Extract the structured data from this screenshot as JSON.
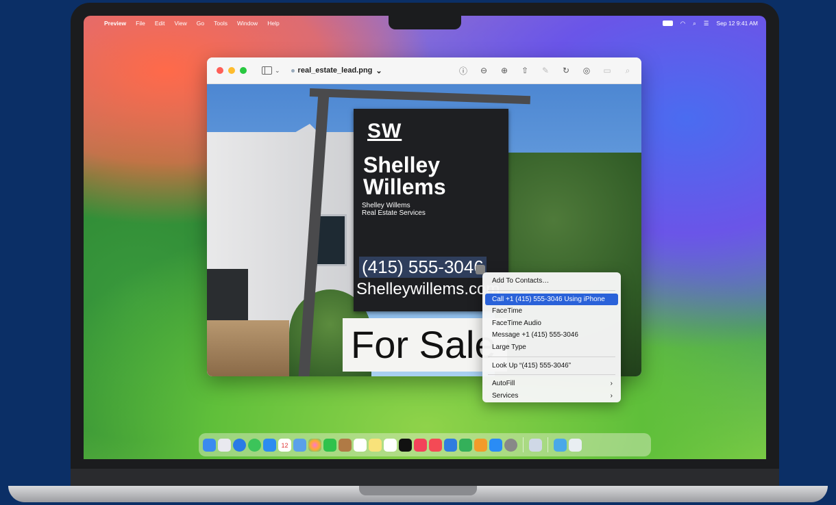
{
  "menubar": {
    "apple_icon": "apple-icon",
    "app_name": "Preview",
    "items": [
      "File",
      "Edit",
      "View",
      "Go",
      "Tools",
      "Window",
      "Help"
    ],
    "status": {
      "datetime": "Sep 12 9:41 AM"
    }
  },
  "window": {
    "filename": "real_estate_lead.png",
    "toolbar_icons": [
      "info-icon",
      "zoom-out-icon",
      "zoom-in-icon",
      "share-icon",
      "markup-icon",
      "rotate-icon",
      "highlight-icon",
      "form-icon",
      "search-icon"
    ]
  },
  "photo": {
    "sign": {
      "monogram": "SW",
      "name_line1": "Shelley",
      "name_line2": "Willems",
      "sub_line1": "Shelley Willems",
      "sub_line2": "Real Estate Services",
      "phone": "(415) 555-3046",
      "website": "Shelleywillems.com"
    },
    "for_sale": "For Sale"
  },
  "context_menu": {
    "items": [
      {
        "label": "Add To Contacts…"
      },
      {
        "label": "Call +1 (415) 555-3046 Using iPhone",
        "selected": true
      },
      {
        "label": "FaceTime"
      },
      {
        "label": "FaceTime Audio"
      },
      {
        "label": "Message +1 (415) 555-3046"
      },
      {
        "label": "Large Type"
      },
      {
        "label": "Look Up “(415) 555-3046”"
      },
      {
        "label": "AutoFill",
        "submenu": true
      },
      {
        "label": "Services",
        "submenu": true
      }
    ],
    "chevron": "›"
  },
  "colors": {
    "background": "#0b2f66",
    "menu_highlight": "#2a62d9"
  },
  "dock": {
    "apps": [
      "finder",
      "launchpad",
      "safari",
      "messages",
      "mail",
      "calendar",
      "photos-alt",
      "photos",
      "facetime",
      "notes-brown",
      "reminders",
      "notes",
      "freeform",
      "tv",
      "music",
      "news",
      "keynote",
      "numbers",
      "pages",
      "app-store",
      "settings",
      "preview",
      "downloads",
      "trash"
    ],
    "calendar_day": "12"
  }
}
